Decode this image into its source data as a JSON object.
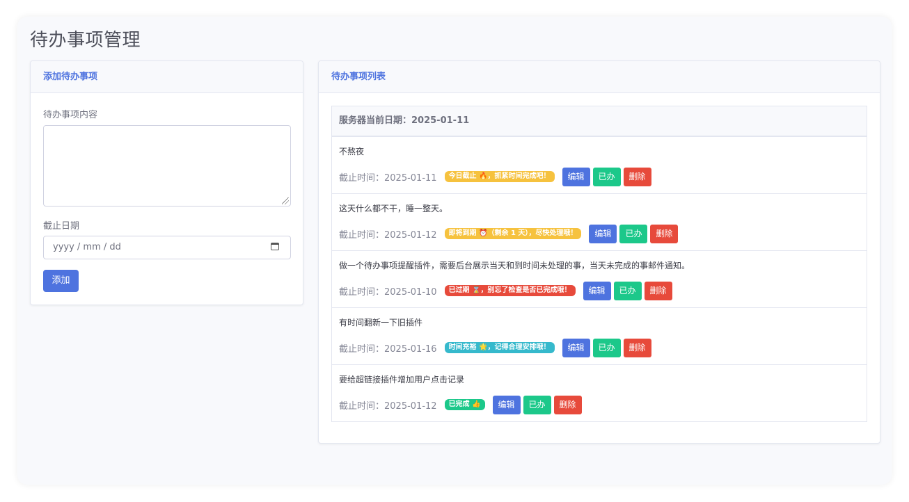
{
  "page": {
    "title": "待办事项管理"
  },
  "add_form": {
    "header": "添加待办事项",
    "content_label": "待办事项内容",
    "content_value": "",
    "date_label": "截止日期",
    "date_placeholder": "yyyy / mm / dd",
    "add_button": "添加"
  },
  "todo_list": {
    "header": "待办事项列表",
    "server_date_label": "服务器当前日期：2025-01-11",
    "buttons": {
      "edit": "编辑",
      "done": "已办",
      "delete": "删除"
    },
    "items": [
      {
        "text": "不熬夜",
        "deadline": "截止时间：2025-01-11",
        "badge": "今日截止 🔥，抓紧时间完成吧！",
        "badge_color": "#f6c23e"
      },
      {
        "text": "这天什么都不干，睡一整天。",
        "deadline": "截止时间：2025-01-12",
        "badge": "即将到期 ⏰（剩余 1 天），尽快处理哦！",
        "badge_color": "#f6c23e"
      },
      {
        "text": "做一个待办事项提醒插件，需要后台展示当天和到时间未处理的事，当天未完成的事邮件通知。",
        "deadline": "截止时间：2025-01-10",
        "badge": "已过期 ⌛，别忘了检查是否已完成哦！",
        "badge_color": "#e74a3b"
      },
      {
        "text": "有时间翻新一下旧插件",
        "deadline": "截止时间：2025-01-16",
        "badge": "时间充裕 🌟，记得合理安排哦！",
        "badge_color": "#36b9cc"
      },
      {
        "text": "要给超链接插件增加用户点击记录",
        "deadline": "截止时间：2025-01-12",
        "badge": "已完成 👍",
        "badge_color": "#1cc88a"
      }
    ]
  },
  "colors": {
    "primary": "#4e73df",
    "success": "#1cc88a",
    "danger": "#e74a3b",
    "warning": "#f6c23e",
    "info": "#36b9cc"
  }
}
